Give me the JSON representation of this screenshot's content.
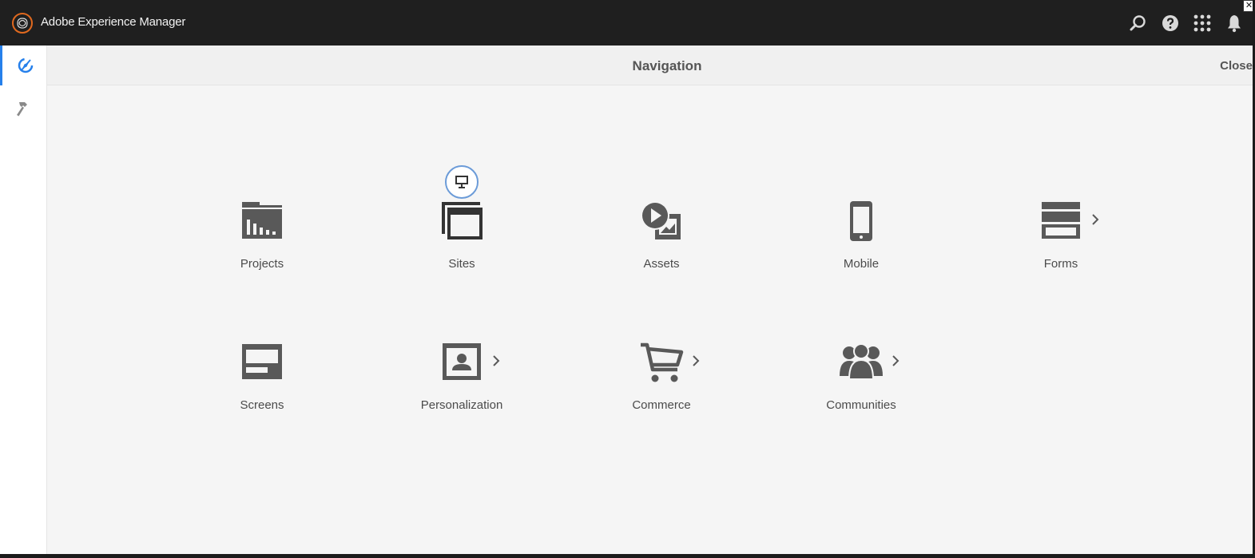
{
  "app": {
    "title": "Adobe Experience Manager"
  },
  "topbar": {
    "icons": [
      "search-icon",
      "help-icon",
      "solutions-grid-icon",
      "notifications-bell-icon"
    ]
  },
  "rail": {
    "items": [
      {
        "icon": "navigation-compass-icon",
        "active": true
      },
      {
        "icon": "tools-hammer-icon",
        "active": false
      }
    ]
  },
  "navigation": {
    "title": "Navigation",
    "close_label": "Close",
    "tiles": [
      {
        "label": "Projects",
        "icon": "projects-icon",
        "has_children": false
      },
      {
        "label": "Sites",
        "icon": "sites-icon",
        "has_children": false
      },
      {
        "label": "Assets",
        "icon": "assets-icon",
        "has_children": false
      },
      {
        "label": "Mobile",
        "icon": "mobile-icon",
        "has_children": false
      },
      {
        "label": "Forms",
        "icon": "forms-icon",
        "has_children": true
      },
      {
        "label": "Screens",
        "icon": "screens-icon",
        "has_children": false
      },
      {
        "label": "Personalization",
        "icon": "personalization-icon",
        "has_children": true
      },
      {
        "label": "Commerce",
        "icon": "commerce-cart-icon",
        "has_children": true
      },
      {
        "label": "Communities",
        "icon": "communities-icon",
        "has_children": true
      }
    ]
  },
  "colors": {
    "topbar": "#1f1f1f",
    "accent": "#2680eb",
    "logo_ring": "#e0691f",
    "icon": "#595959"
  }
}
